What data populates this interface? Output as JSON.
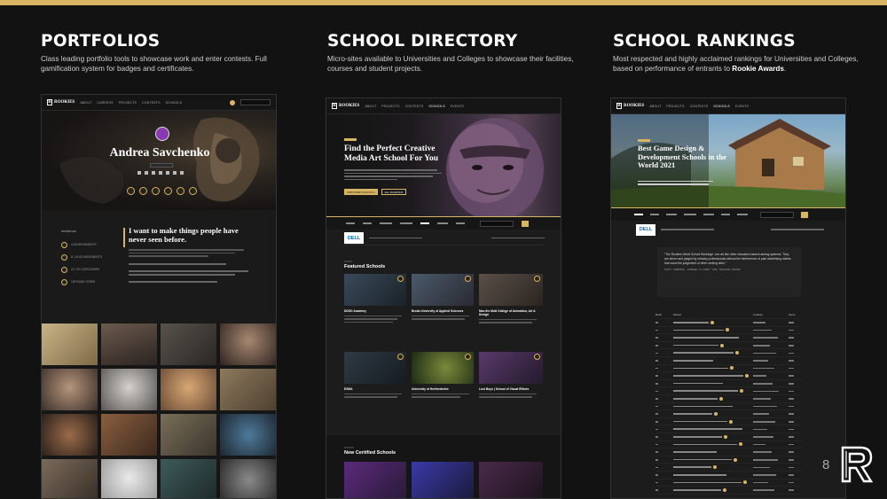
{
  "header": {
    "page_number": "8"
  },
  "portfolios": {
    "title": "PORTFOLIOS",
    "desc": "Class leading portfolio tools to showcase work and enter contests. Full gamification system for badges and certificates.",
    "artist_name": "Andrea Savchenko",
    "tagline": "I want to make things people have never seen before.",
    "nav": [
      "ABOUT",
      "CAREERS",
      "PROJECTS",
      "CONTESTS",
      "SCHOOLS",
      "ABOUT"
    ],
    "stats": [
      "4 ACHIEVEMENTS",
      "8 / 18 ACHIEVEMENTS",
      "22 / 29 CATEGORIES",
      "100 RANK STARS"
    ]
  },
  "directory": {
    "title": "SCHOOL DIRECTORY",
    "desc": "Micro-sites available to Universities and Colleges to showcase their facilities, courses and student projects.",
    "hero_title": "Find the Perfect Creative Media Art School For You",
    "hero_button": "DISCOVER SCHOOLS",
    "hero_button2": "ALL SCHOOLS",
    "section_featured": "Featured Schools",
    "section_certified": "New Certified Schools",
    "schools": [
      "DDSG Academy",
      "Breda University of Applied Sciences",
      "Max the Mutt College of Animation, Art & Design",
      "ESMA",
      "University of Hertfordshire",
      "Lost Boys | School of Visual Effects"
    ],
    "sponsor": "DELL",
    "nav": [
      "ABOUT",
      "PROJECTS",
      "CONTESTS",
      "SCHOOLS",
      "EVENTS"
    ]
  },
  "rankings": {
    "title": "SCHOOL RANKINGS",
    "desc_prefix": "Most respected and highly acclaimed rankings for Universities and Colleges, based on performance of entrants to ",
    "desc_bold": "Rookie Awards",
    "desc_suffix": ".",
    "hero_title": "Best Game Design & Development Schools in the World 2021",
    "quote": "\"The Rookies World School Rankings\" are not like other education based ranking systems. They are driven and judged by industry professionals without the interference of paid advertising dollars that cloud the judgement of other ranking sites.\"",
    "quote_author": "SCOTT THOMPSON, FOUNDER AT FRONT TIME TRAINING CENTRE",
    "sponsor": "DELL",
    "table_headers": [
      "Rank",
      "School",
      "Location",
      "Score"
    ],
    "nav": [
      "ABOUT",
      "PROJECTS",
      "CONTESTS",
      "SCHOOLS",
      "EVENTS"
    ]
  },
  "colors": {
    "accent": "#d8b563",
    "background": "#121212"
  }
}
